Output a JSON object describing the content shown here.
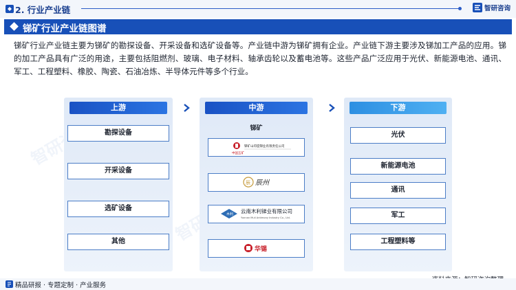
{
  "header": {
    "section_title": "2. 行业产业链",
    "brand": "智研咨询"
  },
  "banner": {
    "title": "锑矿行业产业链图谱"
  },
  "intro": "锑矿行业产业链主要为锑矿的勘探设备、开采设备和选矿设备等。产业链中游为锑矿拥有企业。产业链下游主要涉及锑加工产品的应用。锑的加工产品具有广泛的用途，主要包括阻燃剂、玻璃、电子材料、轴承齿轮以及蓄电池等。这些产品广泛应用于光伏、新能源电池、通讯、军工、工程塑料、橡胶、陶瓷、石油冶炼、半导体元件等多个行业。",
  "upstream": {
    "title": "上游",
    "items": [
      "勘探设备",
      "开采设备",
      "选矿设备",
      "其他"
    ]
  },
  "midstream": {
    "title": "中游",
    "label": "锑矿",
    "logos": [
      {
        "name": "中国五矿",
        "caption": "锑矿山印度锑业有限责任公司",
        "icon": "minmetals-logo"
      },
      {
        "name": "辰州",
        "caption": "",
        "icon": "chenzhou-logo"
      },
      {
        "name": "木利",
        "caption": "云南木利锑业有限公司",
        "sub": "Yunnan Muli Antimony Industry Co., Ltd.",
        "icon": "muli-logo"
      },
      {
        "name": "华锡",
        "caption": "",
        "icon": "huaxi-logo"
      }
    ]
  },
  "downstream": {
    "title": "下游",
    "items": [
      "光伏",
      "新能源电池",
      "通讯",
      "军工",
      "工程塑料等"
    ]
  },
  "source": "资料来源：智研咨询整理",
  "footer": "精品研报 · 专题定制 · 产业服务",
  "colors": {
    "primary": "#1850b8",
    "accent": "#2b74e2",
    "border": "#4a7cc6",
    "panel": "#dfe9f7"
  }
}
